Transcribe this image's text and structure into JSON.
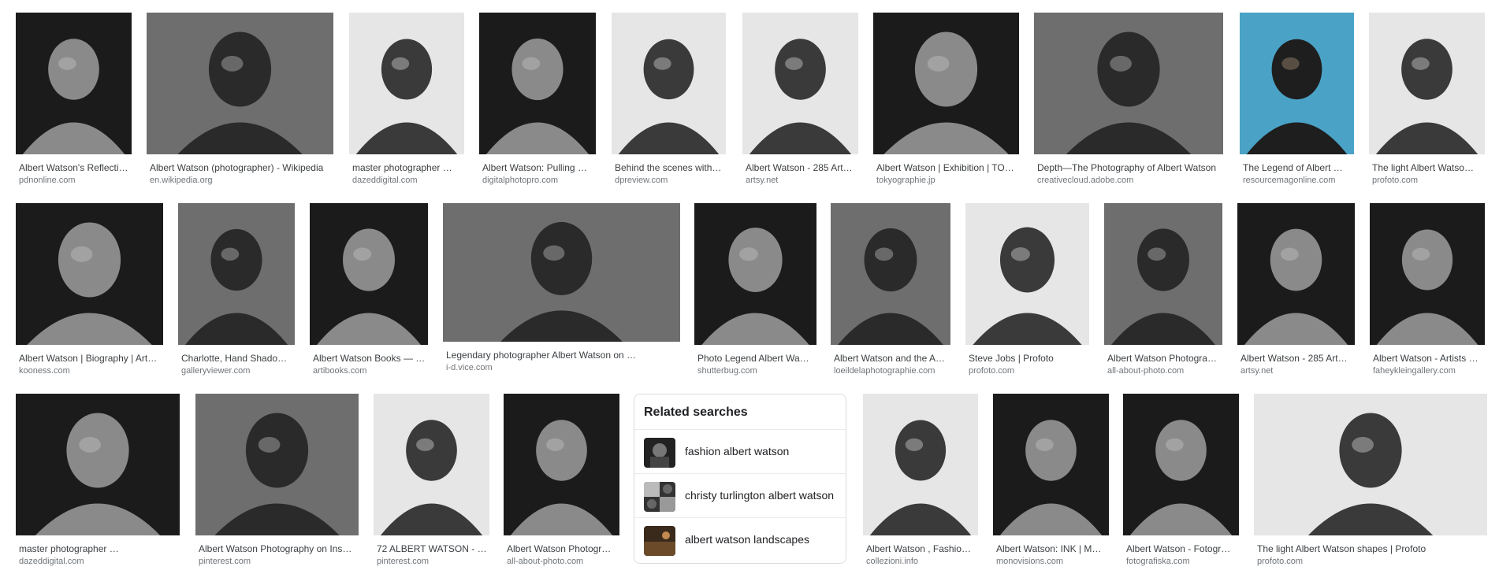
{
  "results": [
    {
      "title": "Albert Watson's Reflecti…",
      "source": "pdnonline.com",
      "shade": "dark"
    },
    {
      "title": "Albert Watson (photographer) - Wikipedia",
      "source": "en.wikipedia.org",
      "shade": "mid"
    },
    {
      "title": "master photographer …",
      "source": "dazeddigital.com",
      "shade": "light"
    },
    {
      "title": "Albert Watson: Pulling …",
      "source": "digitalphotopro.com",
      "shade": "dark"
    },
    {
      "title": "Behind the scenes with…",
      "source": "dpreview.com",
      "shade": "light"
    },
    {
      "title": "Albert Watson - 285 Art…",
      "source": "artsy.net",
      "shade": "light"
    },
    {
      "title": "Albert Watson | Exhibition | TO…",
      "source": "tokyographie.jp",
      "shade": "dark"
    },
    {
      "title": "Depth—The Photography of Albert Watson",
      "source": "creativecloud.adobe.com",
      "shade": "mid"
    },
    {
      "title": "The Legend of Albert …",
      "source": "resourcemagonline.com",
      "shade": "blue"
    },
    {
      "title": "The light Albert Watso…",
      "source": "profoto.com",
      "shade": "light"
    },
    {
      "title": "Albert Watson | Biography | Art…",
      "source": "kooness.com",
      "shade": "dark"
    },
    {
      "title": "Charlotte, Hand Shado…",
      "source": "galleryviewer.com",
      "shade": "mid"
    },
    {
      "title": "Albert Watson Books — …",
      "source": "artibooks.com",
      "shade": "dark"
    },
    {
      "title": "Legendary photographer Albert Watson on …",
      "source": "i-d.vice.com",
      "shade": "mid"
    },
    {
      "title": "Photo Legend Albert Wa…",
      "source": "shutterbug.com",
      "shade": "dark"
    },
    {
      "title": "Albert Watson and the A…",
      "source": "loeildelaphotographie.com",
      "shade": "mid"
    },
    {
      "title": "Steve Jobs | Profoto",
      "source": "profoto.com",
      "shade": "light"
    },
    {
      "title": "Albert Watson Photogra…",
      "source": "all-about-photo.com",
      "shade": "mid"
    },
    {
      "title": "Albert Watson - 285 Art…",
      "source": "artsy.net",
      "shade": "dark"
    },
    {
      "title": "Albert Watson - Artists …",
      "source": "faheykleingallery.com",
      "shade": "dark"
    },
    {
      "title": "master photographer …",
      "source": "dazeddigital.com",
      "shade": "dark"
    },
    {
      "title": "Albert Watson Photography on Ins…",
      "source": "pinterest.com",
      "shade": "mid"
    },
    {
      "title": "72 ALBERT WATSON - …",
      "source": "pinterest.com",
      "shade": "light"
    },
    {
      "title": "Albert Watson Photogr…",
      "source": "all-about-photo.com",
      "shade": "dark"
    },
    {
      "title": "Albert Watson , Fashio…",
      "source": "collezioni.info",
      "shade": "light"
    },
    {
      "title": "Albert Watson: INK | M…",
      "source": "monovisions.com",
      "shade": "dark"
    },
    {
      "title": "Albert Watson - Fotogr…",
      "source": "fotografiska.com",
      "shade": "dark"
    },
    {
      "title": "The light Albert Watson shapes | Profoto",
      "source": "profoto.com",
      "shade": "light"
    }
  ],
  "related": {
    "heading": "Related searches",
    "items": [
      {
        "label": "fashion albert watson"
      },
      {
        "label": "christy turlington albert watson"
      },
      {
        "label": "albert watson landscapes"
      }
    ]
  },
  "colors": {
    "dark": "#1b1b1b",
    "mid": "#6e6e6e",
    "light": "#e6e6e6",
    "blue": "#4aa3c7",
    "title": "#3c4043",
    "source": "#70757a"
  }
}
